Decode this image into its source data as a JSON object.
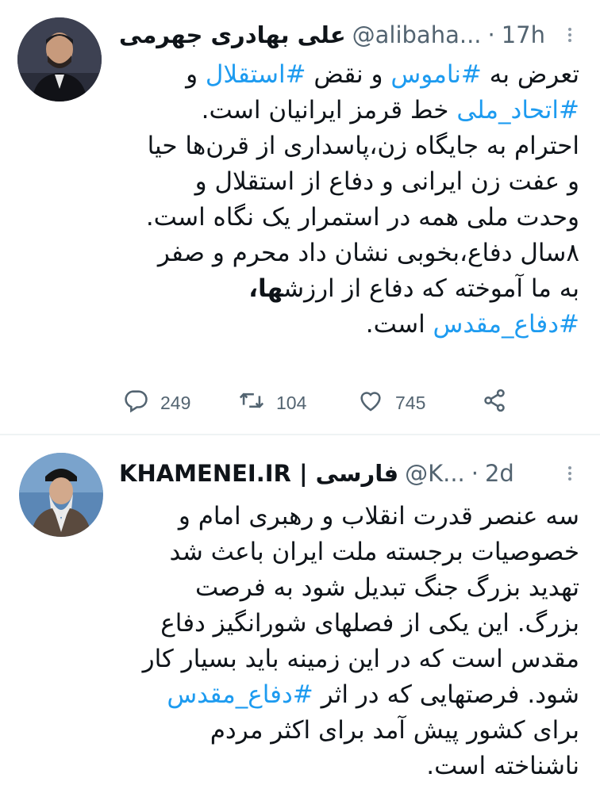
{
  "tweets": [
    {
      "author_name": "علی بهادری جهرمی",
      "handle": "@alibaha...",
      "time": "17h",
      "body_lines": [
        [
          {
            "t": "تعرض به "
          },
          {
            "t": "#ناموس",
            "tag": true
          },
          {
            "t": " و نقض "
          },
          {
            "t": "#استقلال",
            "tag": true
          },
          {
            "t": " و"
          }
        ],
        [
          {
            "t": "#اتحاد_ملی",
            "tag": true
          },
          {
            "t": " خط قرمز ایرانیان است."
          }
        ],
        [
          {
            "t": "احترام به جایگاه زن،پاسداری از قرن‌ها حیا"
          }
        ],
        [
          {
            "t": "و عفت زن ایرانی و دفاع از استقلال و"
          }
        ],
        [
          {
            "t": "وحدت ملی همه در استمرار یک نگاه است."
          }
        ],
        [
          {
            "t": "۸سال دفاع،بخوبی نشان داد محرم و صفر"
          }
        ],
        [
          {
            "t": "به ما آموخته که دفاع از ارزش"
          },
          {
            "t": "ها،",
            "bold": true
          }
        ],
        [
          {
            "t": "#دفاع_مقدس",
            "tag": true
          },
          {
            "t": " است."
          }
        ]
      ],
      "stats": {
        "replies": "249",
        "retweets": "104",
        "likes": "745"
      }
    },
    {
      "author_name": "KHAMENEI.IR | فارسی",
      "handle": "@K...",
      "time": "2d",
      "body_lines": [
        [
          {
            "t": "سه عنصر قدرت انقلاب و رهبری امام و"
          }
        ],
        [
          {
            "t": "خصوصیات برجسته ملت ایران باعث شد"
          }
        ],
        [
          {
            "t": "تهدید بزرگ جنگ تبدیل شود به فرصت"
          }
        ],
        [
          {
            "t": "بزرگ. این یکی از فصلهای شورانگیز دفاع"
          }
        ],
        [
          {
            "t": "مقدس است که در این زمینه باید بسیار کار"
          }
        ],
        [
          {
            "t": "شود.  فرصتهایی که در اثر "
          },
          {
            "t": "#دفاع_مقدس",
            "tag": true
          }
        ],
        [
          {
            "t": "برای کشور پیش آمد برای اکثر مردم"
          }
        ],
        [
          {
            "t": "ناشناخته است."
          }
        ]
      ]
    }
  ],
  "icons": {
    "reply": "reply-icon",
    "retweet": "retweet-icon",
    "like": "like-icon",
    "share": "share-icon",
    "more": "more-icon"
  },
  "colors": {
    "hashtag": "#1d9bf0",
    "secondary": "#536471",
    "divider": "#eff3f4"
  }
}
